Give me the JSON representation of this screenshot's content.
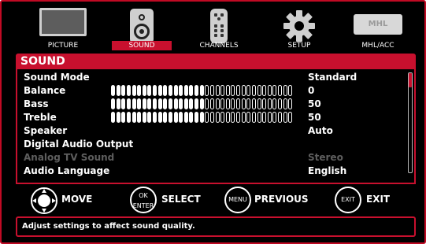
{
  "tabs": [
    {
      "label": "PICTURE",
      "icon": "picture-icon",
      "active": false
    },
    {
      "label": "SOUND",
      "icon": "speaker-icon",
      "active": true
    },
    {
      "label": "CHANNELS",
      "icon": "remote-icon",
      "active": false
    },
    {
      "label": "SETUP",
      "icon": "gear-icon",
      "active": false
    },
    {
      "label": "MHL/ACC",
      "icon": "mhl-icon",
      "active": false,
      "badge": "MHL"
    }
  ],
  "menu": {
    "title": "SOUND",
    "items": [
      {
        "label": "Sound Mode",
        "value": "Standard",
        "enabled": true
      },
      {
        "label": "Balance",
        "value": "0",
        "enabled": true,
        "slider_level": 0.5
      },
      {
        "label": "Bass",
        "value": "50",
        "enabled": true,
        "slider_level": 0.5
      },
      {
        "label": "Treble",
        "value": "50",
        "enabled": true,
        "slider_level": 0.5
      },
      {
        "label": "Speaker",
        "value": "Auto",
        "enabled": true
      },
      {
        "label": "Digital Audio Output",
        "value": "",
        "enabled": true
      },
      {
        "label": "Analog TV Sound",
        "value": "Stereo",
        "enabled": false
      },
      {
        "label": "Audio Language",
        "value": "English",
        "enabled": true
      }
    ],
    "scroll_fraction": 0.14
  },
  "hints": [
    {
      "key": "",
      "label": "MOVE",
      "icon": "dpad-icon"
    },
    {
      "key": "OK ENTER",
      "label": "SELECT",
      "icon": "ok-button-icon"
    },
    {
      "key": "MENU",
      "label": "PREVIOUS",
      "icon": "menu-button-icon"
    },
    {
      "key": "EXIT",
      "label": "EXIT",
      "icon": "exit-button-icon"
    }
  ],
  "status_text": "Adjust settings to affect sound quality.",
  "colors": {
    "accent": "#c8102e",
    "background": "#000000",
    "text": "#ffffff",
    "disabled": "#5e5e5e",
    "slider_filled": "#ffffff"
  }
}
